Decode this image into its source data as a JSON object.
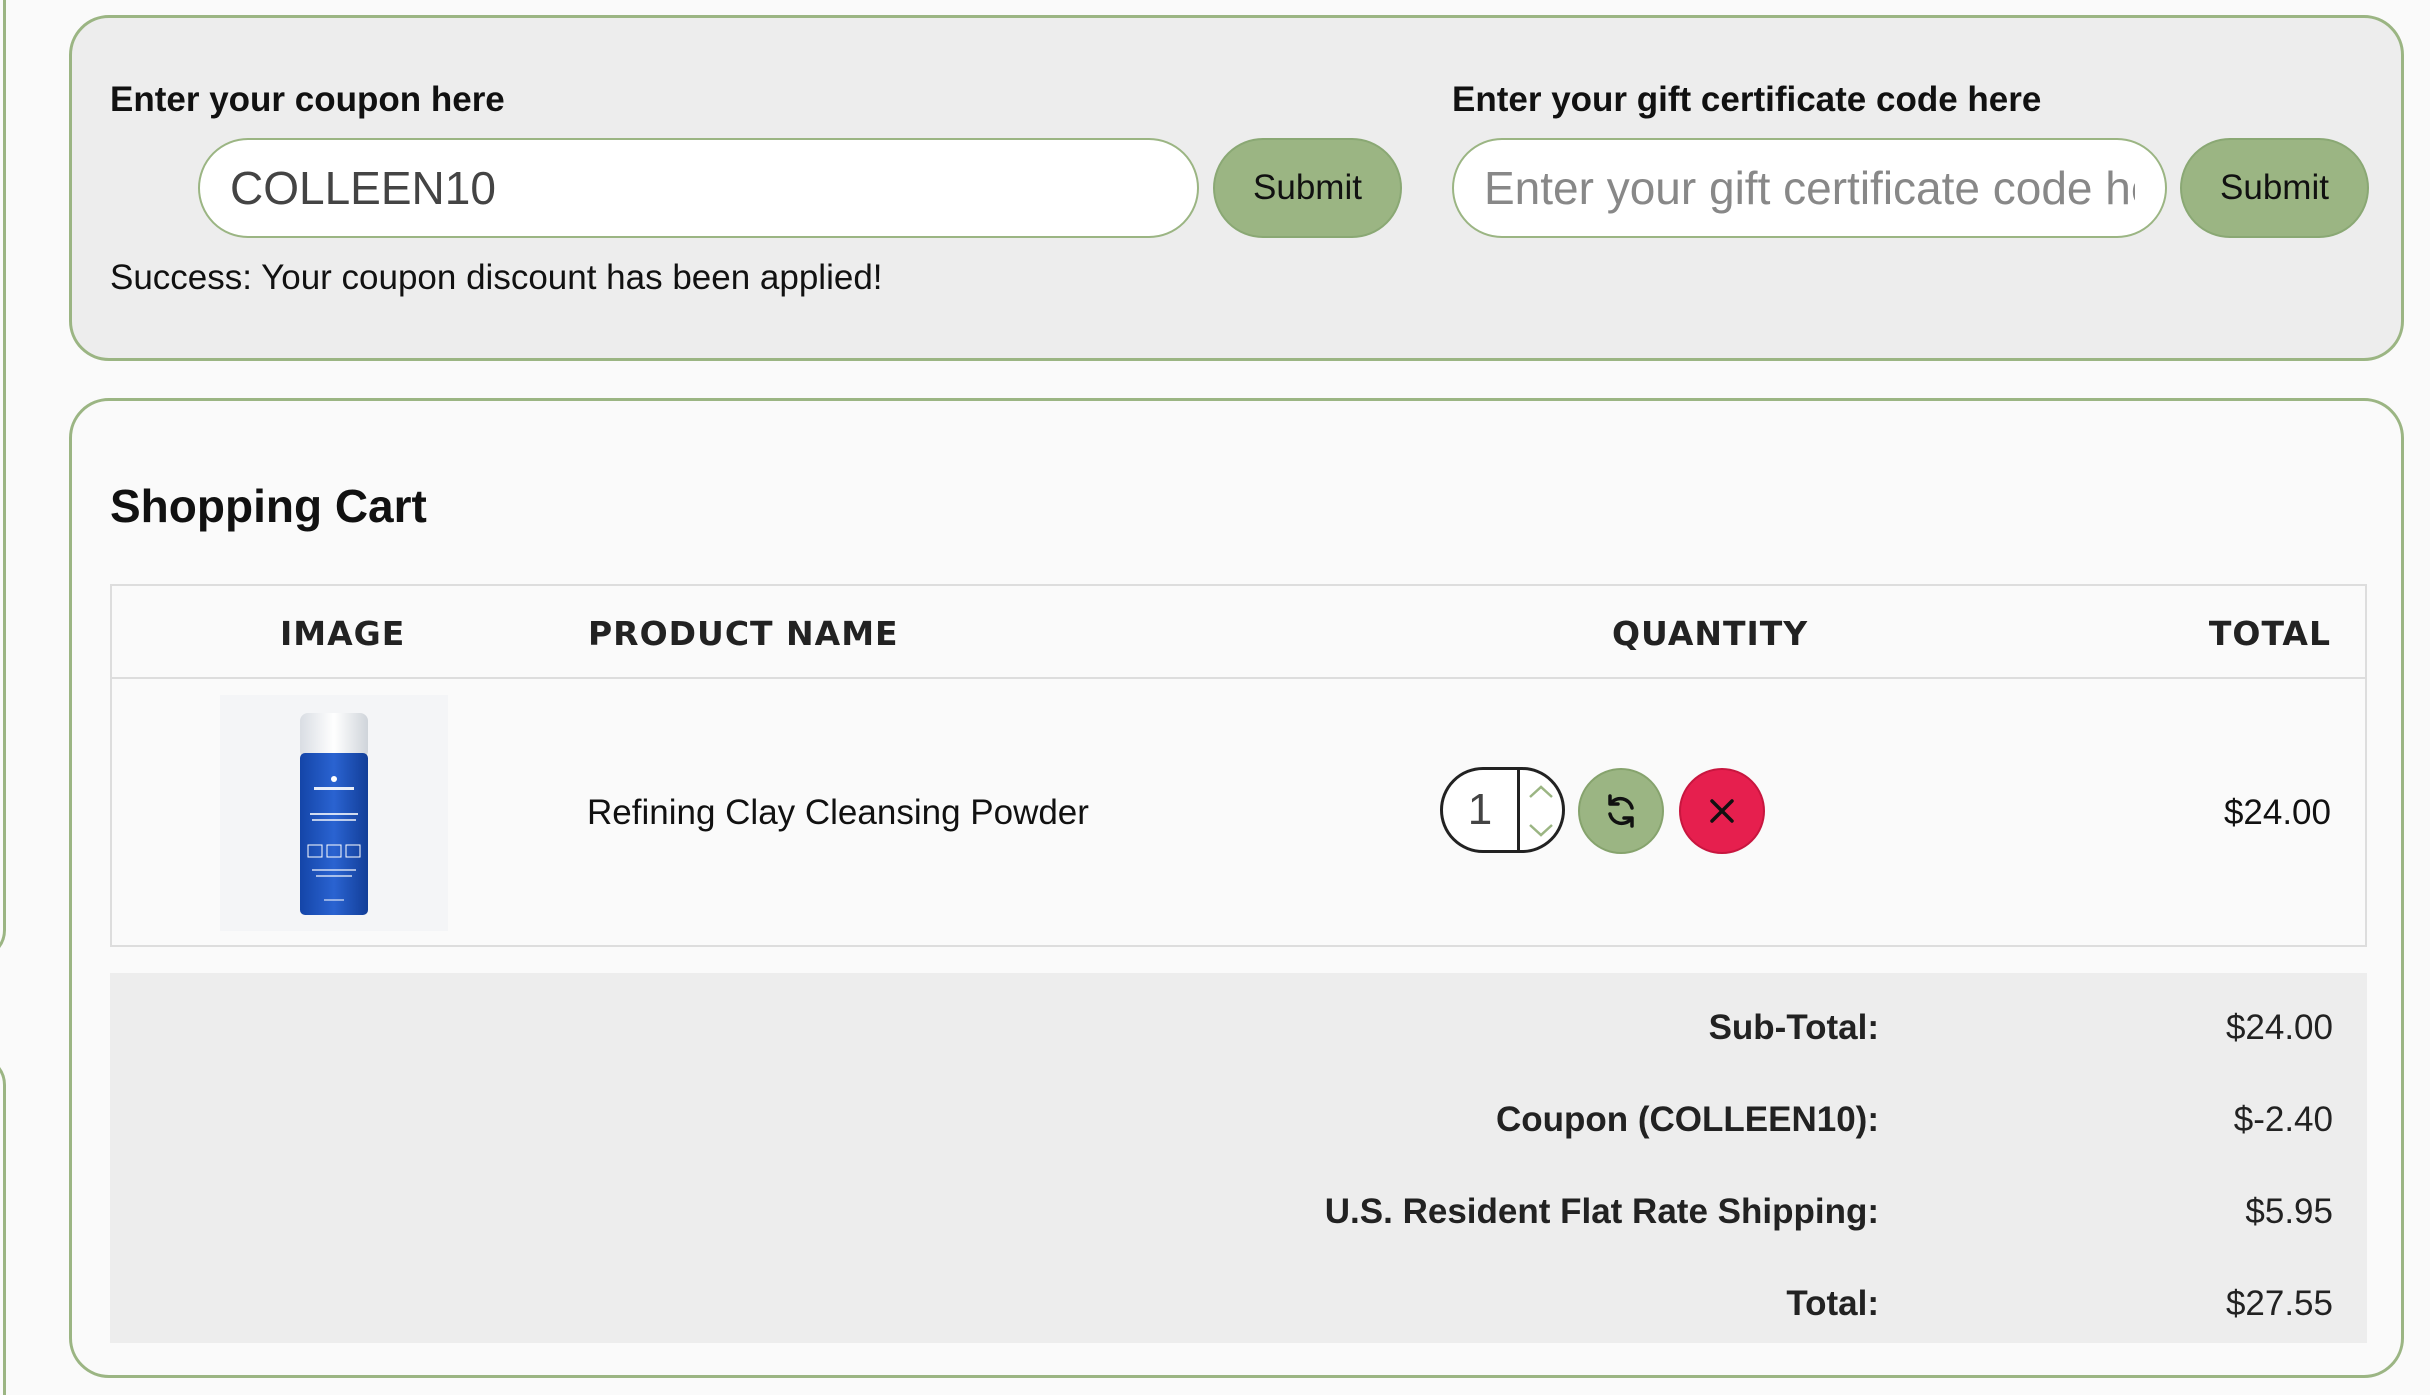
{
  "coupon": {
    "heading": "Enter your coupon here",
    "value": "COLLEEN10",
    "submit_label": "Submit",
    "success_message": "Success: Your coupon discount has been applied!"
  },
  "gift": {
    "heading": "Enter your gift certificate code here",
    "placeholder": "Enter your gift certificate code here",
    "value": "",
    "submit_label": "Submit"
  },
  "cart": {
    "title": "Shopping Cart",
    "columns": {
      "image": "IMAGE",
      "product_name": "PRODUCT NAME",
      "quantity": "QUANTITY",
      "total": "TOTAL"
    },
    "items": [
      {
        "product_name": "Refining Clay Cleansing Powder",
        "quantity": "1",
        "total": "$24.00",
        "image_icon": "product-bottle-icon",
        "brand_mark": "zionhealth"
      }
    ],
    "totals": [
      {
        "label": "Sub-Total:",
        "value": "$24.00"
      },
      {
        "label": "Coupon (COLLEEN10):",
        "value": "$-2.40"
      },
      {
        "label": "U.S. Resident Flat Rate Shipping:",
        "value": "$5.95"
      },
      {
        "label": "Total:",
        "value": "$27.55"
      }
    ]
  },
  "colors": {
    "accent_green": "#9bb583",
    "remove_red": "#e61f4e",
    "panel_gray": "#ededed"
  }
}
